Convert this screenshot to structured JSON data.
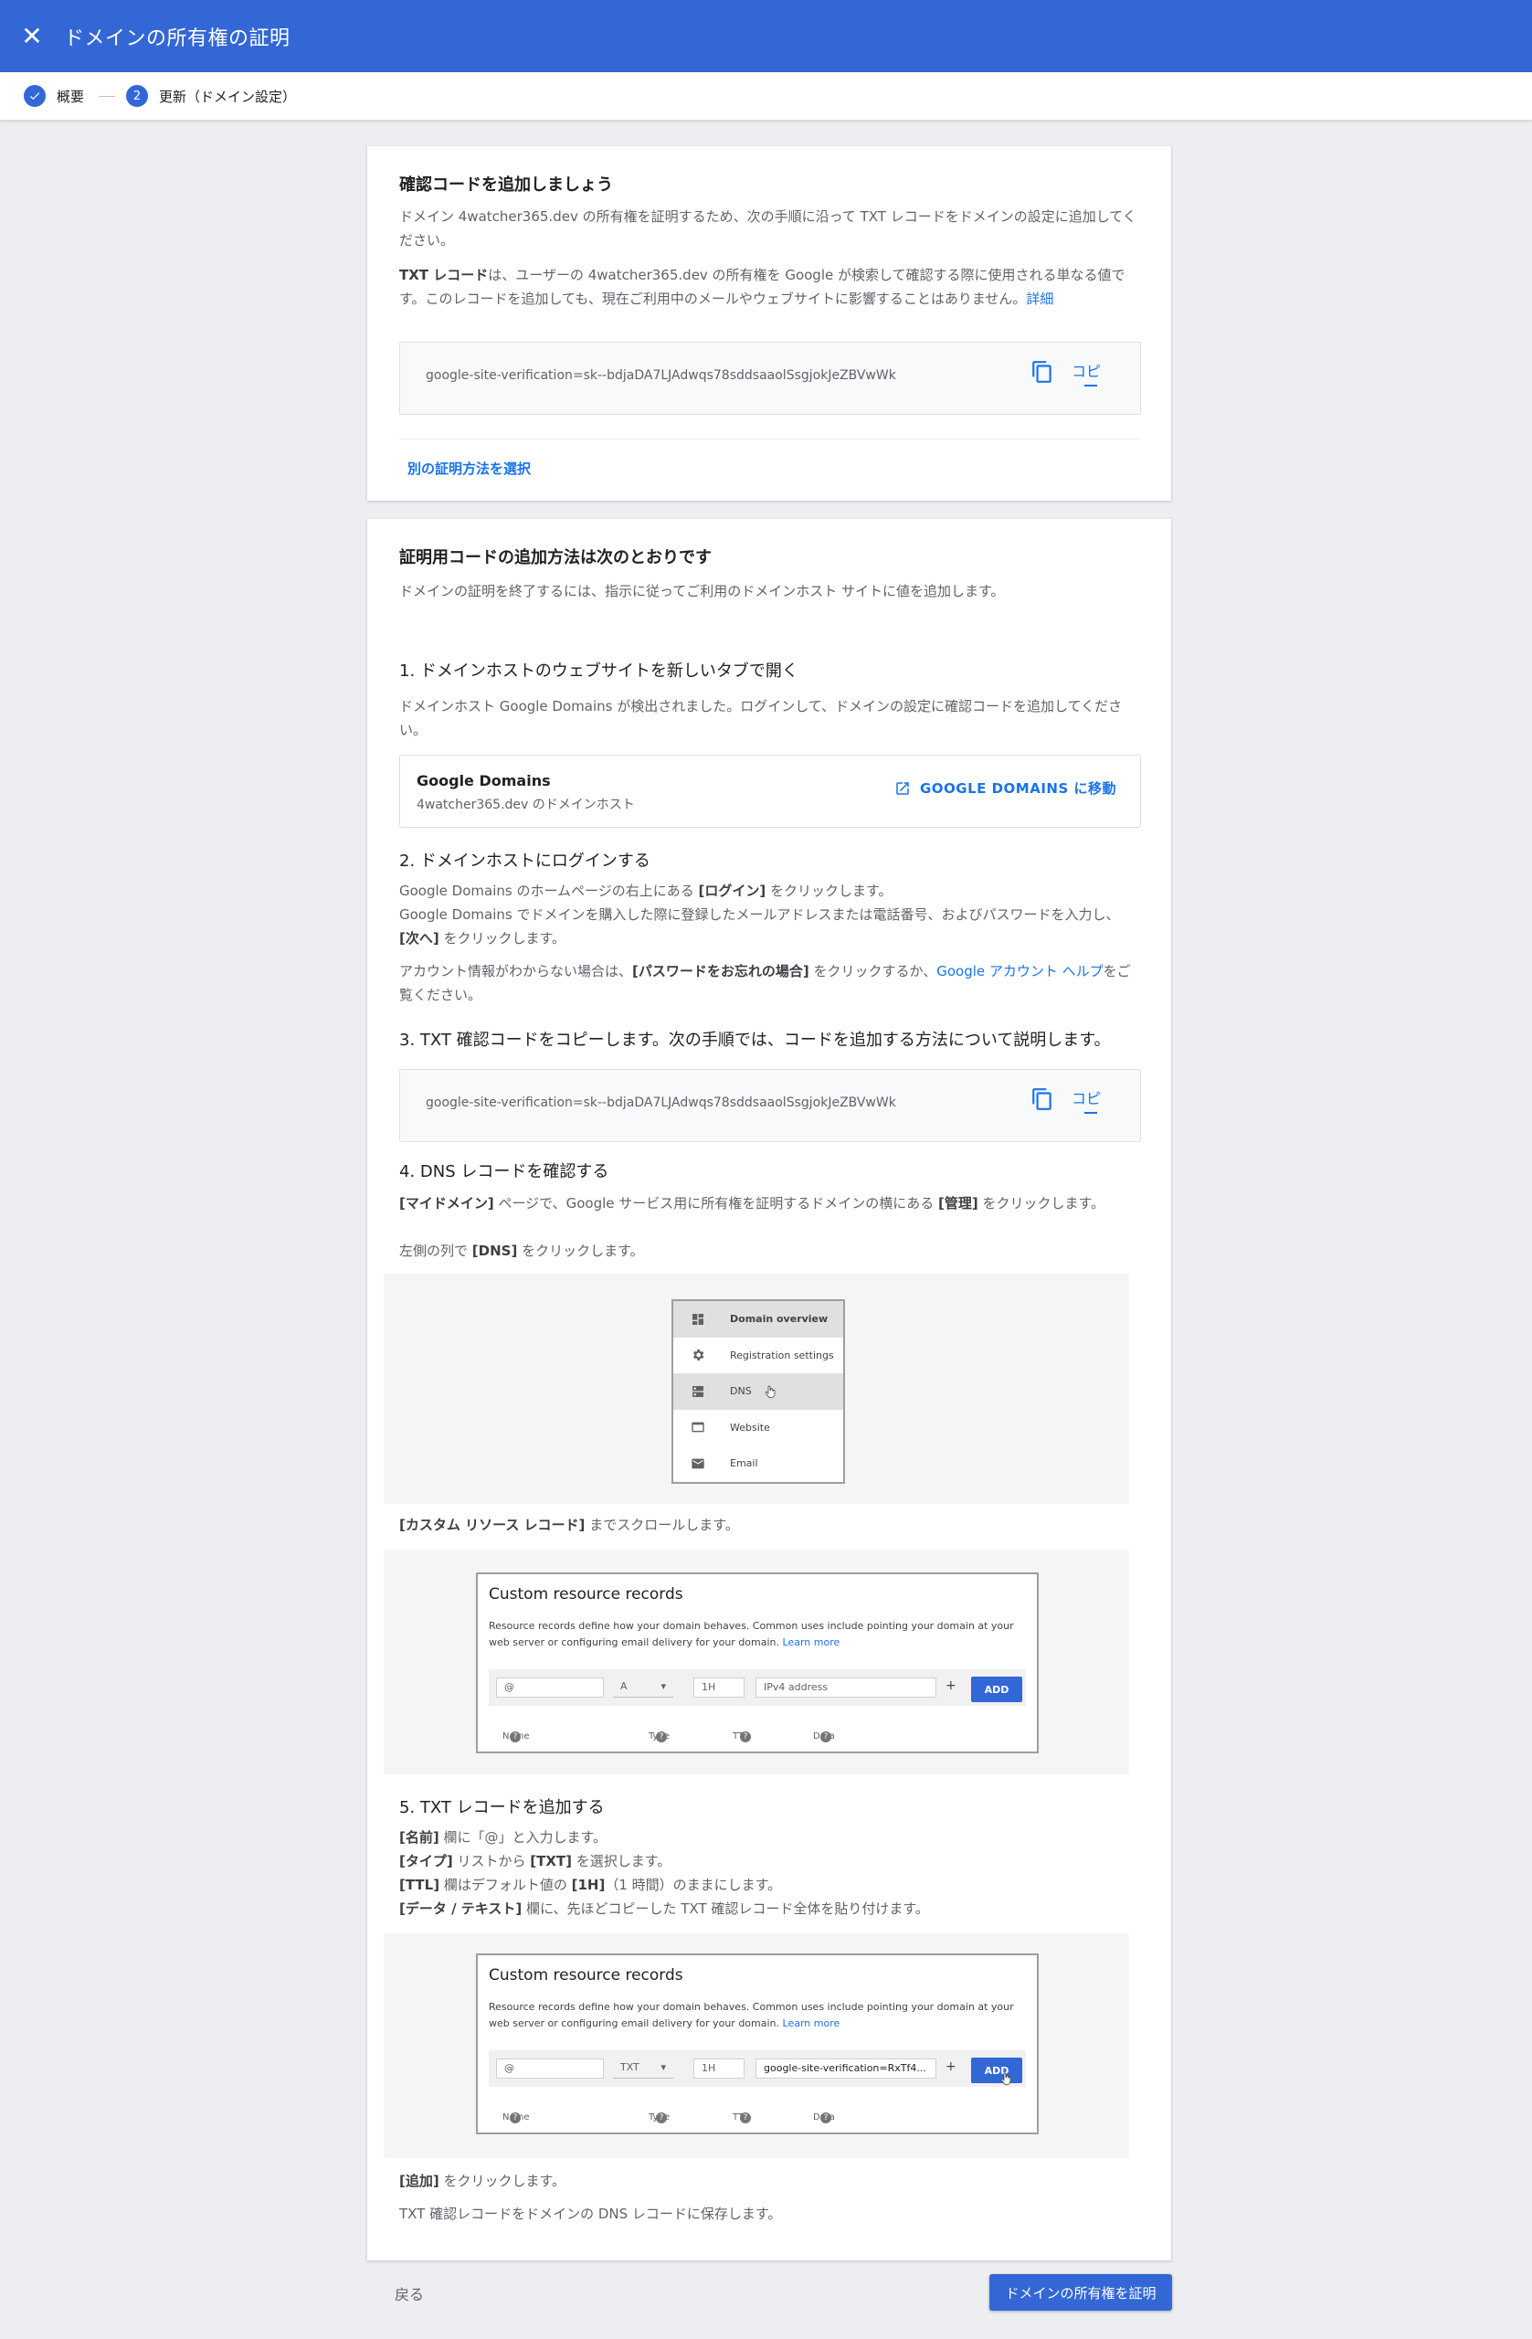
{
  "header": {
    "title": "ドメインの所有権の証明"
  },
  "stepper": {
    "step1_label": "概要",
    "step2_number": "2",
    "step2_label": "更新（ドメイン設定）"
  },
  "card1": {
    "title": "確認コードを追加しましょう",
    "para1": "ドメイン 4watcher365.dev の所有権を証明するため、次の手順に沿って TXT レコードをドメインの設定に追加してください。",
    "para2_bold": "TXT レコード",
    "para2_text": "は、ユーザーの 4watcher365.dev の所有権を Google が検索して確認する際に使用される単なる値です。このレコードを追加しても、現在ご利用中のメールやウェブサイトに影響することはありません。",
    "para2_link": "詳細",
    "code": "google-site-verification=sk--bdjaDA7LJAdwqs78sddsaaolSsgjokJeZBVwWk",
    "copy_label": "コピ",
    "alt_method": "別の証明方法を選択"
  },
  "card2": {
    "title": "証明用コードの追加方法は次のとおりです",
    "intro": "ドメインの証明を終了するには、指示に従ってご利用のドメインホスト サイトに値を追加します。",
    "step1": {
      "heading": "1. ドメインホストのウェブサイトを新しいタブで開く",
      "text": "ドメインホスト Google Domains が検出されました。ログインして、ドメインの設定に確認コードを追加してください。",
      "host_name": "Google Domains",
      "host_sub": "4watcher365.dev のドメインホスト",
      "goto_label": "GOOGLE DOMAINS に移動"
    },
    "step2": {
      "heading": "2. ドメインホストにログインする",
      "line1_a": "Google Domains のホームページの右上にある ",
      "line1_b": "[ログイン]",
      "line1_c": " をクリックします。",
      "line2_a": "Google Domains でドメインを購入した際に登録したメールアドレスまたは電話番号、およびパスワードを入力し、",
      "line2_b": "[次へ]",
      "line2_c": " をクリックします。",
      "line3_a": "アカウント情報がわからない場合は、",
      "line3_b": "[パスワードをお忘れの場合]",
      "line3_c": " をクリックするか、",
      "line3_link": "Google アカウント ヘルプ",
      "line3_d": "をご覧ください。"
    },
    "step3": {
      "heading": "3. TXT 確認コードをコピーします。次の手順では、コードを追加する方法について説明します。",
      "code": "google-site-verification=sk--bdjaDA7LJAdwqs78sddsaaolSsgjokJeZBVwWk",
      "copy_label": "コピ"
    },
    "step4": {
      "heading": "4. DNS レコードを確認する",
      "line1_b": "[マイドメイン]",
      "line1_a": " ページで、Google サービス用に所有権を証明するドメインの横にある ",
      "line1_c": "[管理]",
      "line1_d": " をクリックします。",
      "line2_a": "左側の列で ",
      "line2_b": "[DNS]",
      "line2_c": " をクリックします。",
      "menu": [
        "Domain overview",
        "Registration settings",
        "DNS",
        "Website",
        "Email"
      ],
      "scroll_b": "[カスタム リソース レコード]",
      "scroll_a": " までスクロールします。"
    },
    "crr": {
      "title": "Custom resource records",
      "desc": "Resource records define how your domain behaves. Common uses include pointing your domain at your web server or configuring email delivery for your domain.",
      "learn_more": "Learn more",
      "name_val": "@",
      "type_a": "A",
      "type_txt": "TXT",
      "ttl": "1H",
      "data_placeholder": "IPv4 address",
      "data_filled": "google-site-verification=RxTf4...",
      "plus": "+",
      "add": "ADD",
      "col_name": "Name",
      "col_type": "Type",
      "col_ttl": "TTL",
      "col_data": "Data",
      "q": "?"
    },
    "step5": {
      "heading": "5. TXT レコードを追加する",
      "l1_b": "[名前]",
      "l1_a": " 欄に「@」と入力します。",
      "l2_b": "[タイプ]",
      "l2_a": " リストから ",
      "l2_c": "[TXT]",
      "l2_d": " を選択します。",
      "l3_b": "[TTL]",
      "l3_a": " 欄はデフォルト値の ",
      "l3_c": "[1H]",
      "l3_d": "（1 時間）のままにします。",
      "l4_b": "[データ / テキスト]",
      "l4_a": " 欄に、先ほどコピーした TXT 確認レコード全体を貼り付けます。",
      "add_b": "[追加]",
      "add_a": " をクリックします。",
      "save": "TXT 確認レコードをドメインの DNS レコードに保存します。"
    }
  },
  "footer": {
    "back": "戻る",
    "verify": "ドメインの所有権を証明"
  }
}
